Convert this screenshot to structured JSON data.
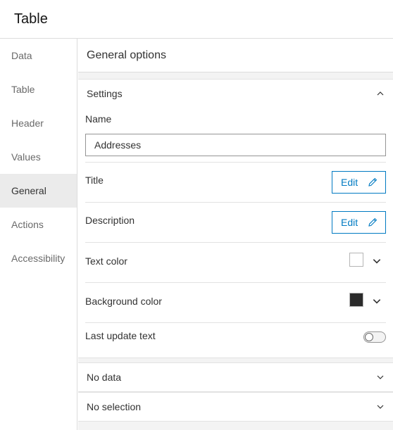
{
  "window": {
    "title": "Table"
  },
  "sidebar": {
    "items": [
      {
        "label": "Data"
      },
      {
        "label": "Table"
      },
      {
        "label": "Header"
      },
      {
        "label": "Values"
      },
      {
        "label": "General"
      },
      {
        "label": "Actions"
      },
      {
        "label": "Accessibility"
      }
    ],
    "active": "General"
  },
  "panel": {
    "title": "General options",
    "settings": {
      "title": "Settings",
      "name_label": "Name",
      "name_value": "Addresses",
      "title_label": "Title",
      "description_label": "Description",
      "edit_label": "Edit",
      "text_color_label": "Text color",
      "text_color": "#ffffff",
      "background_color_label": "Background color",
      "background_color": "#2b2b2b",
      "last_update_label": "Last update text",
      "last_update_enabled": false
    },
    "no_data": {
      "title": "No data"
    },
    "no_selection": {
      "title": "No selection"
    }
  },
  "colors": {
    "accent": "#007ac2"
  },
  "icons": {
    "expanded": "chevron-up-icon",
    "collapsed": "chevron-down-icon",
    "edit": "pencil-icon"
  }
}
